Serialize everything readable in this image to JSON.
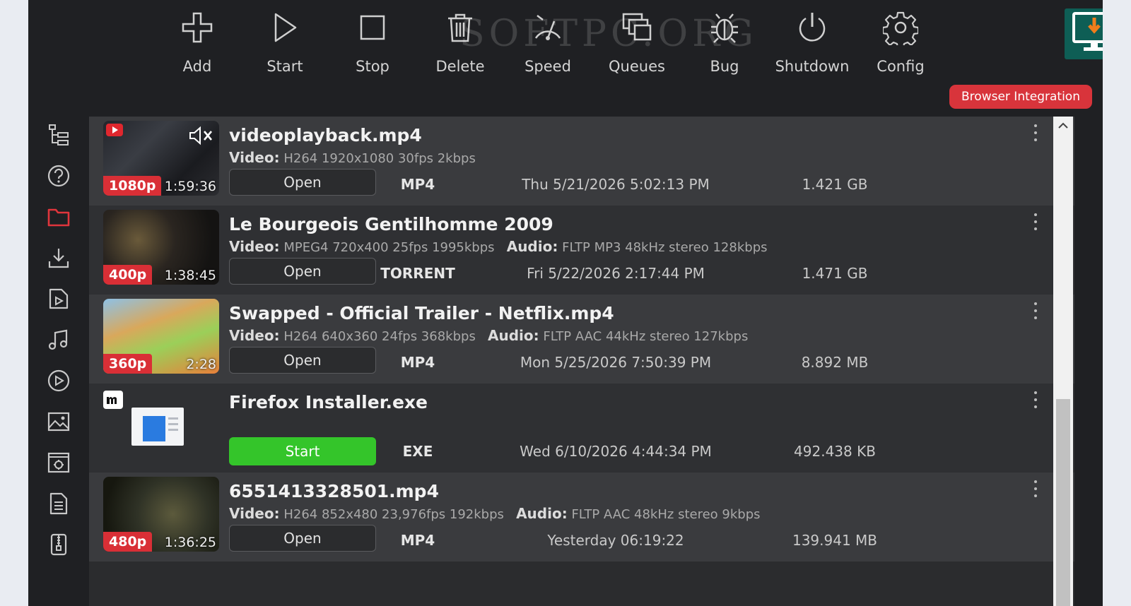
{
  "toolbar": {
    "buttons": [
      {
        "label": "Add",
        "icon": "plus-icon"
      },
      {
        "label": "Start",
        "icon": "play-icon"
      },
      {
        "label": "Stop",
        "icon": "stop-icon"
      },
      {
        "label": "Delete",
        "icon": "trash-icon"
      },
      {
        "label": "Speed",
        "icon": "speed-icon"
      },
      {
        "label": "Queues",
        "icon": "queues-icon"
      },
      {
        "label": "Bug",
        "icon": "bug-icon"
      },
      {
        "label": "Shutdown",
        "icon": "power-icon"
      },
      {
        "label": "Config",
        "icon": "gear-icon"
      }
    ],
    "watermark": "SOFTPC.ORG",
    "browser_integration": "Browser Integration"
  },
  "sidebar": {
    "items": [
      "tree-icon",
      "help-icon",
      "folder-icon",
      "download-icon",
      "video-file-icon",
      "music-icon",
      "play-circle-icon",
      "image-icon",
      "settings-box-icon",
      "document-icon",
      "archive-icon"
    ],
    "active": "folder-icon"
  },
  "downloads": [
    {
      "title": "videoplayback.mp4",
      "resolution": "1080p",
      "duration": "1:59:36",
      "video_label": "Video:",
      "video": "H264 1920x1080 30fps 2kbps",
      "audio_label": "",
      "audio": "",
      "action": "Open",
      "ext": "MP4",
      "date": "Thu 5/21/2026 5:02:13 PM",
      "size": "1.421 GB"
    },
    {
      "title": "Le Bourgeois Gentilhomme  2009",
      "resolution": "400p",
      "duration": "1:38:45",
      "video_label": "Video:",
      "video": "MPEG4 720x400 25fps 1995kbps",
      "audio_label": "Audio:",
      "audio": "FLTP MP3 48kHz stereo 128kbps",
      "action": "Open",
      "ext": "TORRENT",
      "date": "Fri 5/22/2026 2:17:44 PM",
      "size": "1.471 GB"
    },
    {
      "title": "Swapped - Official Trailer - Netflix.mp4",
      "resolution": "360p",
      "duration": "2:28",
      "video_label": "Video:",
      "video": "H264 640x360 24fps 368kbps",
      "audio_label": "Audio:",
      "audio": "FLTP AAC 44kHz stereo 127kbps",
      "action": "Open",
      "ext": "MP4",
      "date": "Mon 5/25/2026 7:50:39 PM",
      "size": "8.892 MB"
    },
    {
      "title": "Firefox Installer.exe",
      "resolution": "",
      "duration": "",
      "video_label": "",
      "video": "",
      "audio_label": "",
      "audio": "",
      "action": "Start",
      "ext": "EXE",
      "date": "Wed 6/10/2026 4:44:34 PM",
      "size": "492.438 KB"
    },
    {
      "title": "6551413328501.mp4",
      "resolution": "480p",
      "duration": "1:36:25",
      "video_label": "Video:",
      "video": "H264 852x480 23,976fps 192kbps",
      "audio_label": "Audio:",
      "audio": "FLTP AAC 48kHz stereo 9kbps",
      "action": "Open",
      "ext": "MP4",
      "date": "Yesterday 06:19:22",
      "size": "139.941 MB"
    }
  ],
  "colors": {
    "accent_red": "#d92f36",
    "start_green": "#34c52a",
    "background": "#1f2023"
  }
}
